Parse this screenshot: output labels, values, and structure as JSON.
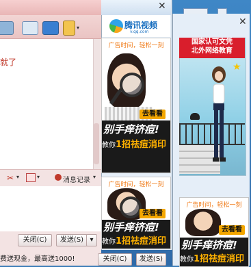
{
  "chat": {
    "message_fragment": "就了",
    "toolbar_record": "消息记录",
    "close_button": "关闭(C)",
    "send_button": "发送(S)",
    "promo_text": "费送现金，最高送1000!"
  },
  "video_ad": {
    "logo_text": "腾讯视频",
    "logo_sub": "v.qq.com",
    "ad_header": "广告时间，轻松一刻",
    "go_button": "去看看",
    "slogan": "别手痒挤痘!",
    "sub_slogan_prefix": "教你",
    "sub_slogan_highlight": "1招祛痘消印"
  },
  "right_ad": {
    "banner_line1": "国家认可文凭",
    "banner_line2": "北外网络教育",
    "ad_header": "广告时间，轻松一刻",
    "go_button": "去看看",
    "slogan": "别手痒挤痘!",
    "sub_slogan_prefix": "教你",
    "sub_slogan_highlight": "1招祛痘消印"
  },
  "bottom_bar": {
    "close_button": "关闭(C)",
    "send_button": "发送(S)"
  },
  "colors": {
    "ad_header": "#f07c1a",
    "highlight": "#ffb100",
    "banner_red": "#d91e2c"
  }
}
